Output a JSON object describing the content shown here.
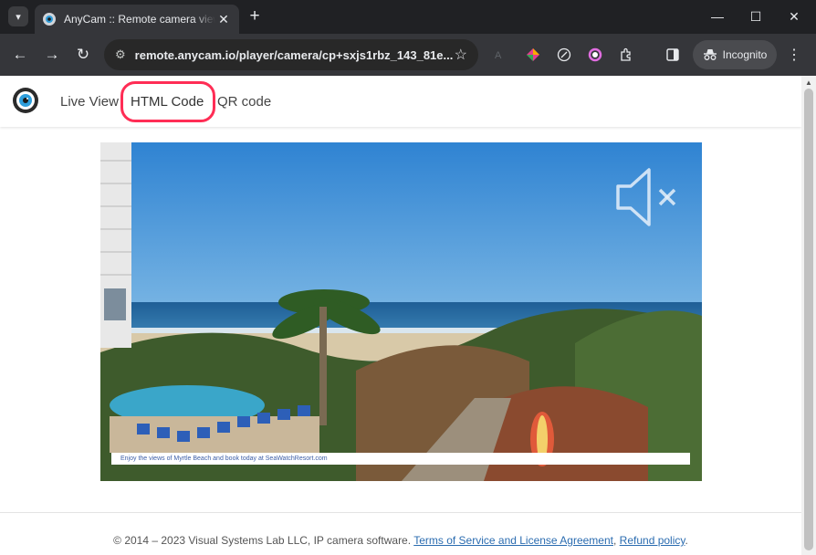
{
  "browser": {
    "tab_title": "AnyCam :: Remote camera view",
    "url": "remote.anycam.io/player/camera/cp+sxjs1rbz_143_81e...",
    "incognito_label": "Incognito"
  },
  "nav": {
    "live_view": "Live View",
    "html_code": "HTML Code",
    "qr_code": "QR code"
  },
  "camera": {
    "banner_text": "Enjoy the views of Myrtle Beach and book today at SeaWatchResort.com",
    "muted": true
  },
  "footer": {
    "copyright": "© 2014 – 2023 Visual Systems Lab LLC, IP camera software.",
    "terms_link": "Terms of Service and License Agreement",
    "separator": ",",
    "refund_link": "Refund policy",
    "end": "."
  },
  "colors": {
    "highlight": "#ff2d55",
    "link": "#2b6cb0",
    "sky": "#3d8fd6",
    "ocean": "#2a6fa8"
  }
}
